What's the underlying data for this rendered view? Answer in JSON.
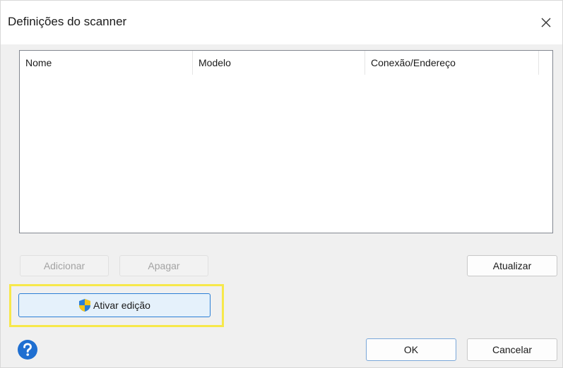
{
  "window": {
    "title": "Definições do scanner",
    "close_icon": "close-icon"
  },
  "list": {
    "columns": [
      "Nome",
      "Modelo",
      "Conexão/Endereço"
    ],
    "rows": []
  },
  "buttons": {
    "add": "Adicionar",
    "delete": "Apagar",
    "refresh": "Atualizar",
    "enable_edit": "Ativar edição",
    "ok": "OK",
    "cancel": "Cancelar"
  },
  "icons": {
    "shield": "uac-shield-icon",
    "help": "help-icon"
  },
  "colors": {
    "highlight": "#f7e84a",
    "accent": "#2b7fd6",
    "help": "#1f6fd1"
  }
}
